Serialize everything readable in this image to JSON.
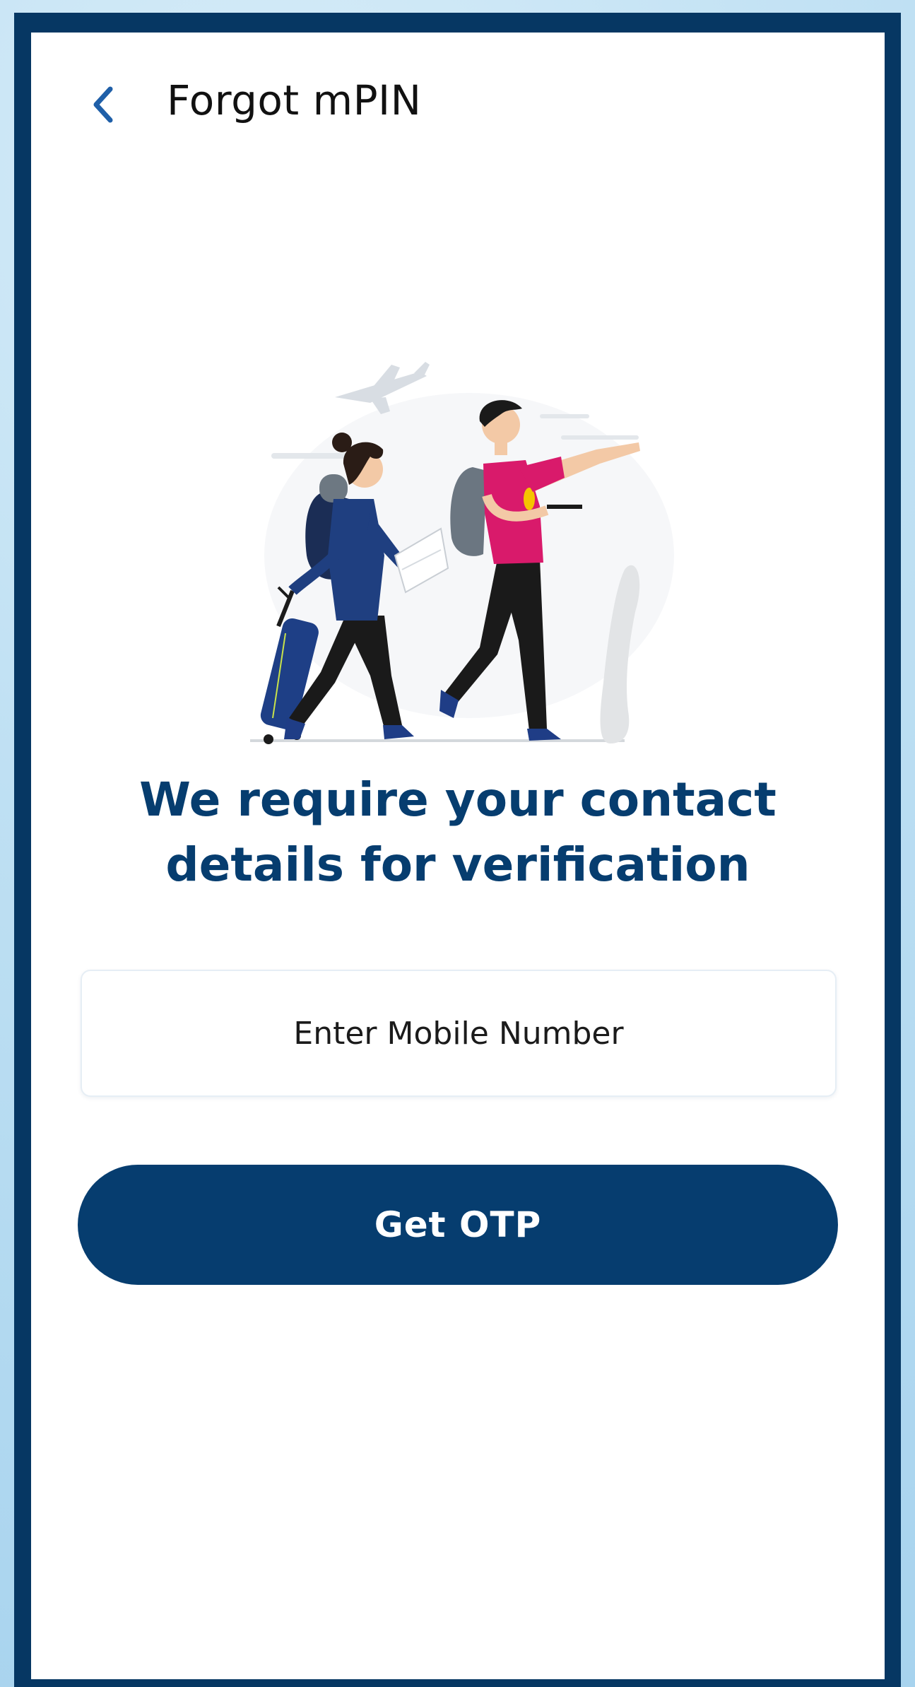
{
  "header": {
    "back_icon": "chevron-left-icon",
    "title": "Forgot mPIN"
  },
  "main": {
    "heading": "We require your contact details for verification",
    "mobile_input": {
      "placeholder": "Enter Mobile Number",
      "value": ""
    },
    "get_otp_label": "Get OTP"
  },
  "colors": {
    "primary": "#063d6f",
    "frame": "#063763",
    "background": "#ffffff",
    "accent_blue": "#1f5fa8",
    "pink_shirt": "#d91a6b"
  }
}
